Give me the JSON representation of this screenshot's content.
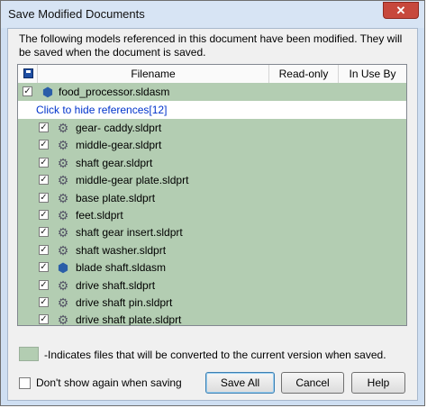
{
  "window": {
    "title": "Save Modified Documents",
    "close_label": "✕"
  },
  "description": "The following models referenced in this document have been modified. They will be saved when the document is saved.",
  "columns": {
    "filename": "Filename",
    "readonly": "Read-only",
    "inuseby": "In Use By"
  },
  "top_item": {
    "name": "food_processor.sldasm",
    "checked": true,
    "icon": "assembly-icon"
  },
  "toggle_link": "Click to hide references[12]",
  "references": [
    {
      "name": "gear- caddy.sldprt",
      "icon": "part-icon"
    },
    {
      "name": "middle-gear.sldprt",
      "icon": "part-icon"
    },
    {
      "name": "shaft gear.sldprt",
      "icon": "part-icon"
    },
    {
      "name": "middle-gear plate.sldprt",
      "icon": "part-icon"
    },
    {
      "name": "base plate.sldprt",
      "icon": "part-icon"
    },
    {
      "name": "feet.sldprt",
      "icon": "part-icon"
    },
    {
      "name": "shaft gear insert.sldprt",
      "icon": "part-icon"
    },
    {
      "name": "shaft washer.sldprt",
      "icon": "part-icon"
    },
    {
      "name": "blade shaft.sldasm",
      "icon": "assembly-icon"
    },
    {
      "name": "drive shaft.sldprt",
      "icon": "part-icon"
    },
    {
      "name": "drive shaft pin.sldprt",
      "icon": "part-icon"
    },
    {
      "name": "drive shaft plate.sldprt",
      "icon": "part-icon"
    }
  ],
  "legend_text": "-Indicates files that will be converted to the current version when saved.",
  "dont_show_label": "Don't show again when saving",
  "buttons": {
    "save_all": "Save All",
    "cancel": "Cancel",
    "help": "Help"
  },
  "colors": {
    "convert_highlight": "#b3cdb2",
    "link": "#0033cc"
  }
}
